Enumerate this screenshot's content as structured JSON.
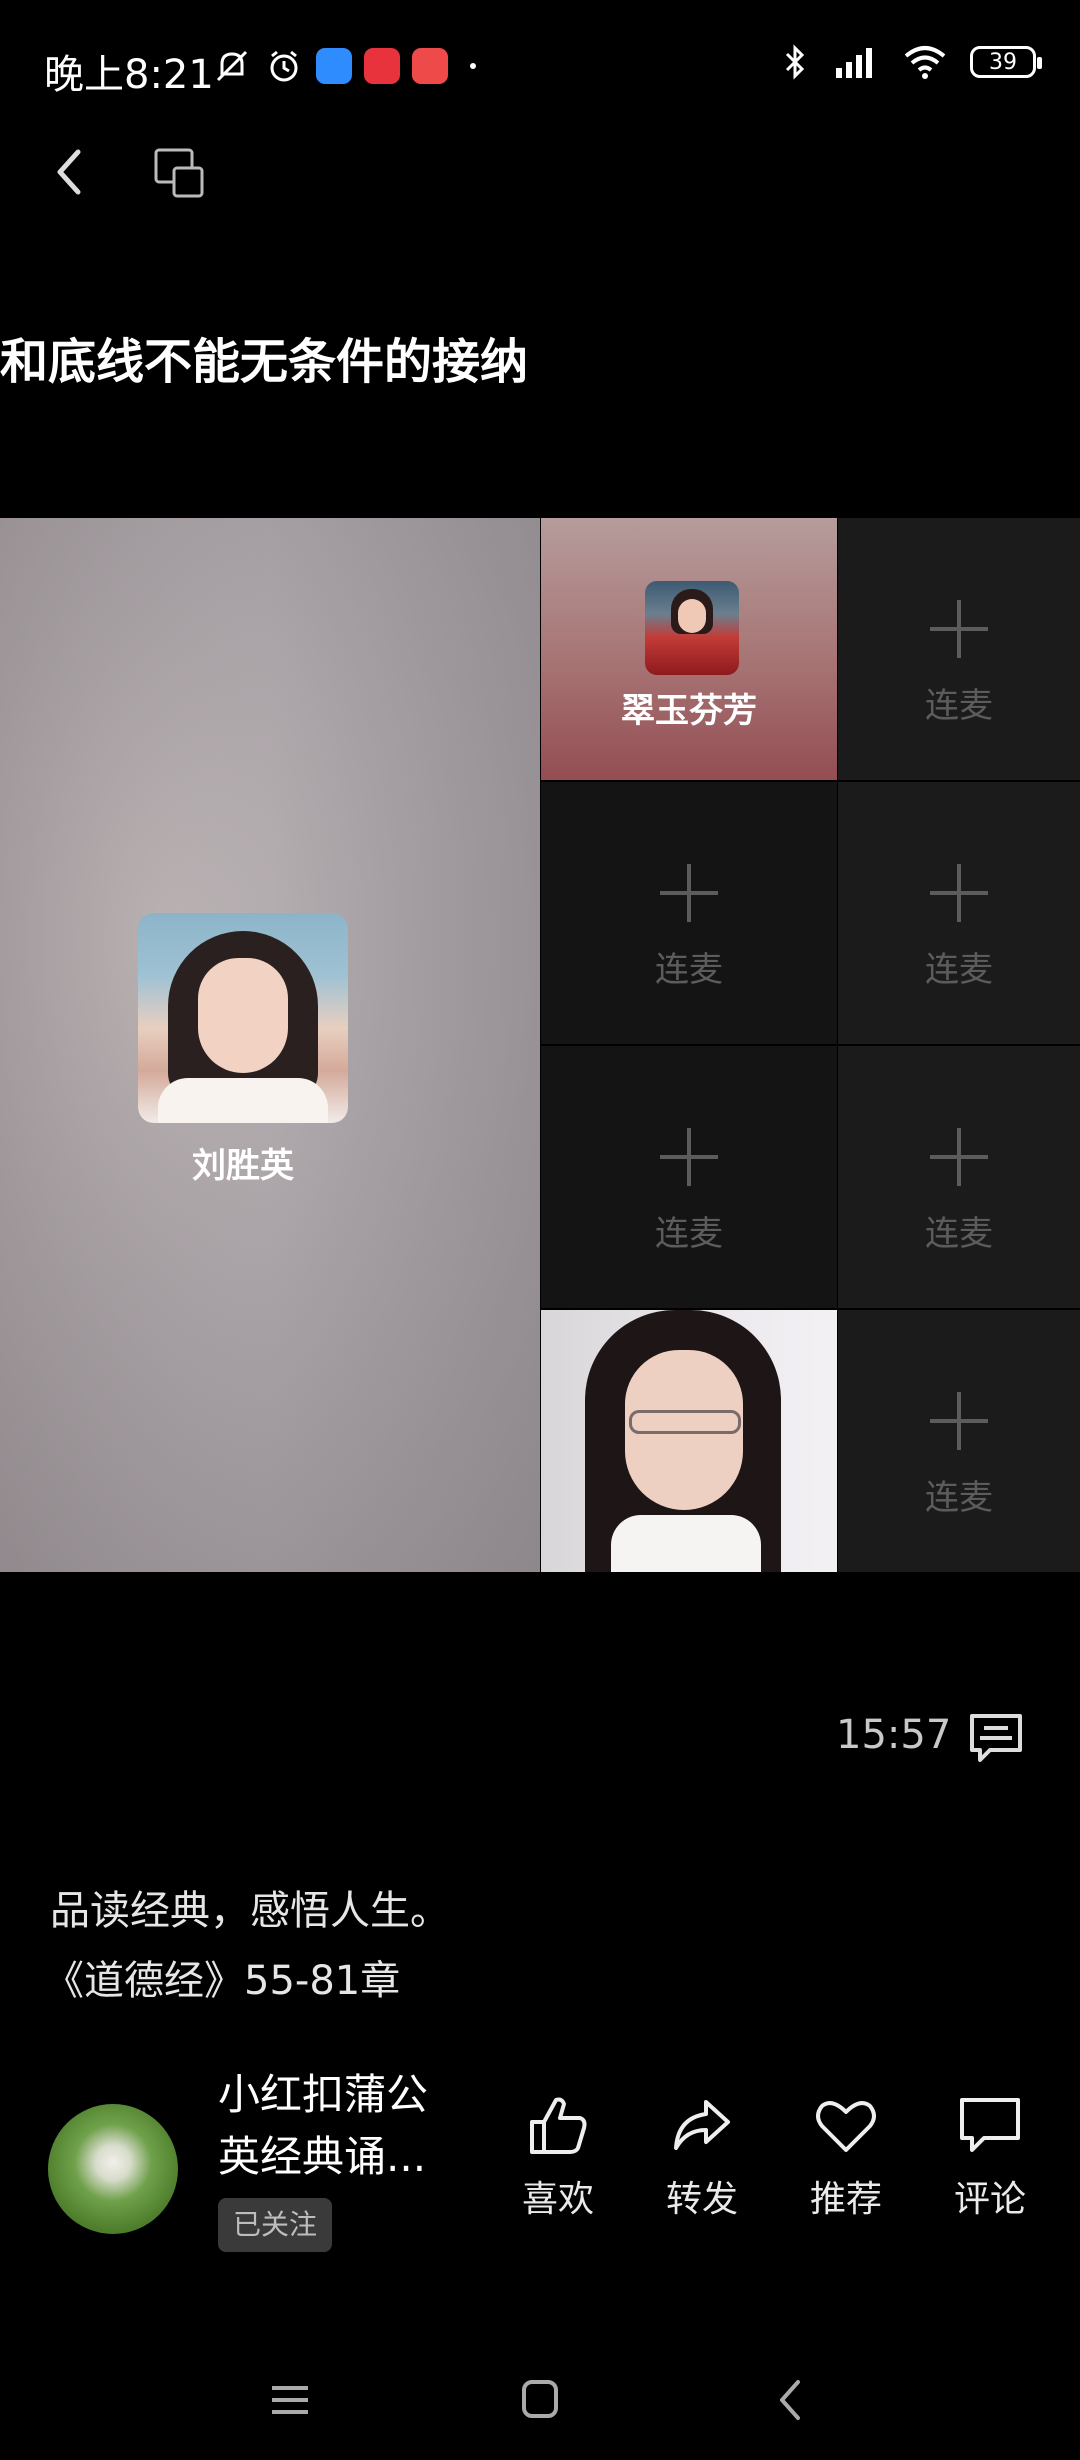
{
  "status_bar": {
    "time": "晚上8:21",
    "battery": "39",
    "icons": [
      "mute-icon",
      "alarm-icon",
      "app-icon-blue",
      "app-icon-red-heart",
      "app-icon-red",
      "dot-icon",
      "bluetooth-icon",
      "signal-icon",
      "wifi-icon",
      "battery-icon"
    ]
  },
  "banner": {
    "text": "和底线不能无条件的接纳"
  },
  "grid": {
    "host_name": "刘胜英",
    "guest_name": "翠玉芬芳",
    "empty_slot_label": "连麦",
    "slots": [
      {
        "label": "连麦"
      },
      {
        "label": "连麦"
      },
      {
        "label": "连麦"
      },
      {
        "label": "连麦"
      },
      {
        "label": "连麦"
      },
      {
        "label": "连麦"
      }
    ]
  },
  "duration": "15:57",
  "description": {
    "line1": "品读经典，感悟人生。",
    "line2": "《道德经》55-81章"
  },
  "author": {
    "name": "小红扣蒲公英经典诵...",
    "follow_status": "已关注"
  },
  "actions": {
    "like": "喜欢",
    "share": "转发",
    "recommend": "推荐",
    "comment": "评论"
  },
  "colors": {
    "background": "#000000",
    "slot_bg": "#141414",
    "slot_text": "#5c5c5c"
  }
}
